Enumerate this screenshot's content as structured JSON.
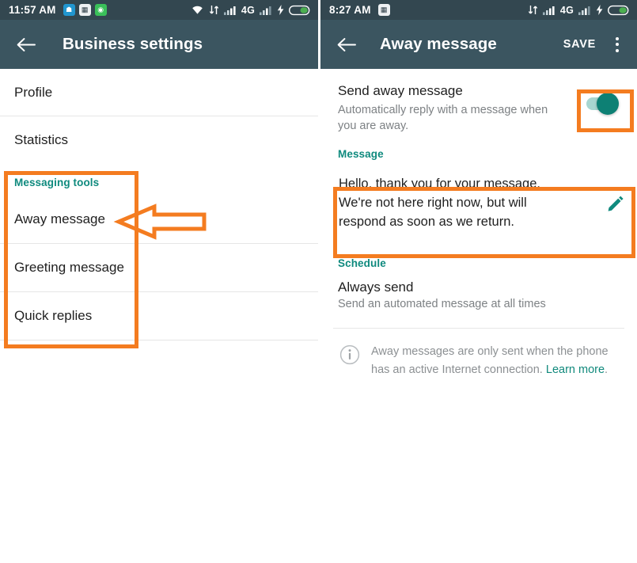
{
  "left": {
    "statusbar": {
      "time": "11:57 AM",
      "notification_icons": [
        "wallet-icon",
        "news-icon",
        "android-icon"
      ],
      "right_icons": [
        "wifi-icon",
        "data-transfer-icon",
        "signal-1-icon",
        "signal-2-icon",
        "charging-bolt-icon",
        "battery-icon"
      ],
      "network_label": "4G"
    },
    "appbar": {
      "back_icon": "back-arrow-icon",
      "title": "Business settings"
    },
    "items": [
      {
        "label": "Profile"
      },
      {
        "label": "Statistics"
      }
    ],
    "messaging_tools": {
      "section_label": "Messaging tools",
      "items": [
        {
          "label": "Away message"
        },
        {
          "label": "Greeting message"
        },
        {
          "label": "Quick replies"
        }
      ]
    },
    "annotations": {
      "box_label": "messaging-tools-highlight",
      "arrow_label": "away-message-pointer"
    }
  },
  "right": {
    "statusbar": {
      "time": "8:27 AM",
      "notification_icons": [
        "news-icon"
      ],
      "right_icons": [
        "data-transfer-icon",
        "signal-1-icon",
        "signal-2-icon",
        "charging-bolt-icon",
        "battery-icon"
      ],
      "network_label": "4G"
    },
    "appbar": {
      "back_icon": "back-arrow-icon",
      "title": "Away message",
      "save_label": "SAVE",
      "overflow_icon": "kebab-menu-icon"
    },
    "send_away": {
      "title": "Send away message",
      "subtitle": "Automatically reply with a message when you are away.",
      "toggle_on": true
    },
    "message": {
      "section_label": "Message",
      "body": "Hello, thank you for your message.\nWe're not here right now, but will\nrespond as soon as we return.",
      "edit_icon": "pencil-icon"
    },
    "schedule": {
      "section_label": "Schedule",
      "title": "Always send",
      "subtitle": "Send an automated message at all times"
    },
    "footer": {
      "icon": "info-icon",
      "text": "Away messages are only sent when the phone has an active Internet connection. ",
      "link_text": "Learn more",
      "text_end": "."
    },
    "annotations": {
      "toggle_box_label": "toggle-highlight",
      "message_box_label": "message-highlight"
    }
  },
  "colors": {
    "statusbar_bg": "#334750",
    "appbar_bg": "#3b5560",
    "accent_teal": "#0f8a7e",
    "annotation_orange": "#f47c20",
    "toggle_track": "#a8d6d0",
    "toggle_knob": "#0d8074"
  }
}
